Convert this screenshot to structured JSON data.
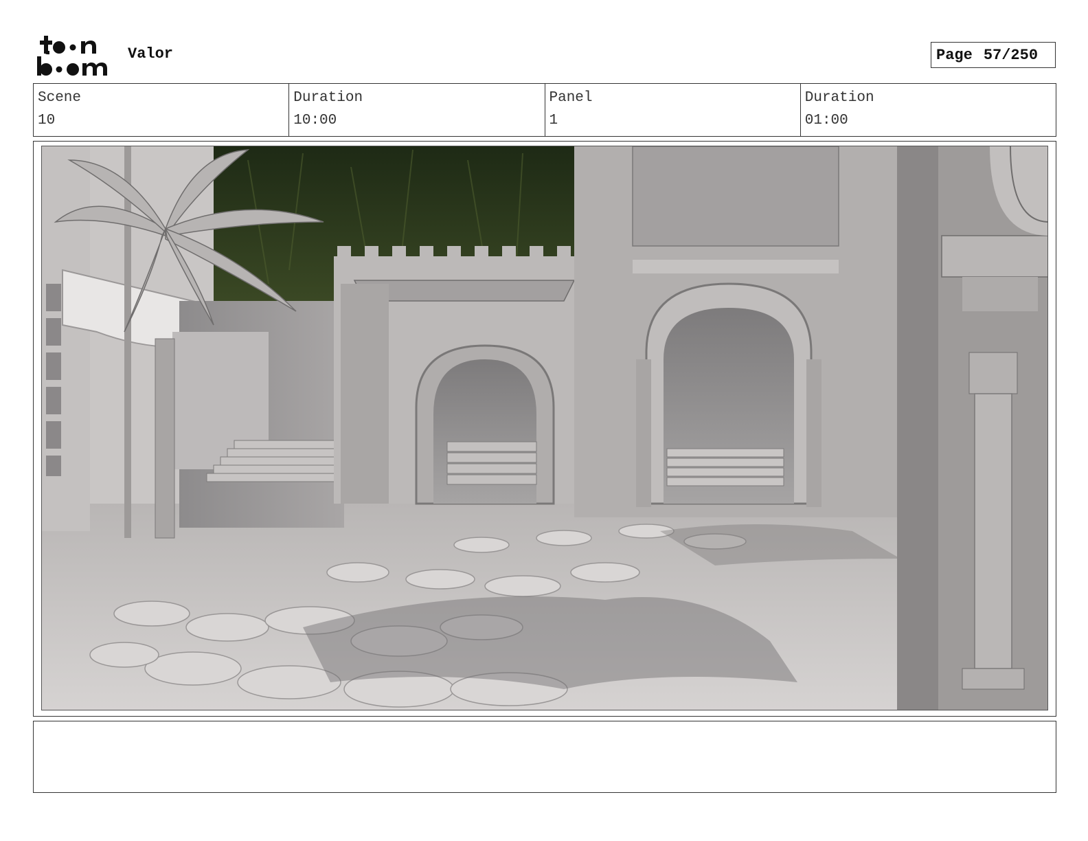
{
  "header": {
    "logo_text": "toon boom",
    "project_title": "Valor",
    "page_label": "Page",
    "page_number": "57/250"
  },
  "meta": [
    {
      "label": "Scene",
      "value": "10"
    },
    {
      "label": "Duration",
      "value": "10:00"
    },
    {
      "label": "Panel",
      "value": "1"
    },
    {
      "label": "Duration",
      "value": "01:00"
    }
  ],
  "panel_image": {
    "icon": "storyboard-render-image"
  },
  "notes": {
    "text": ""
  }
}
